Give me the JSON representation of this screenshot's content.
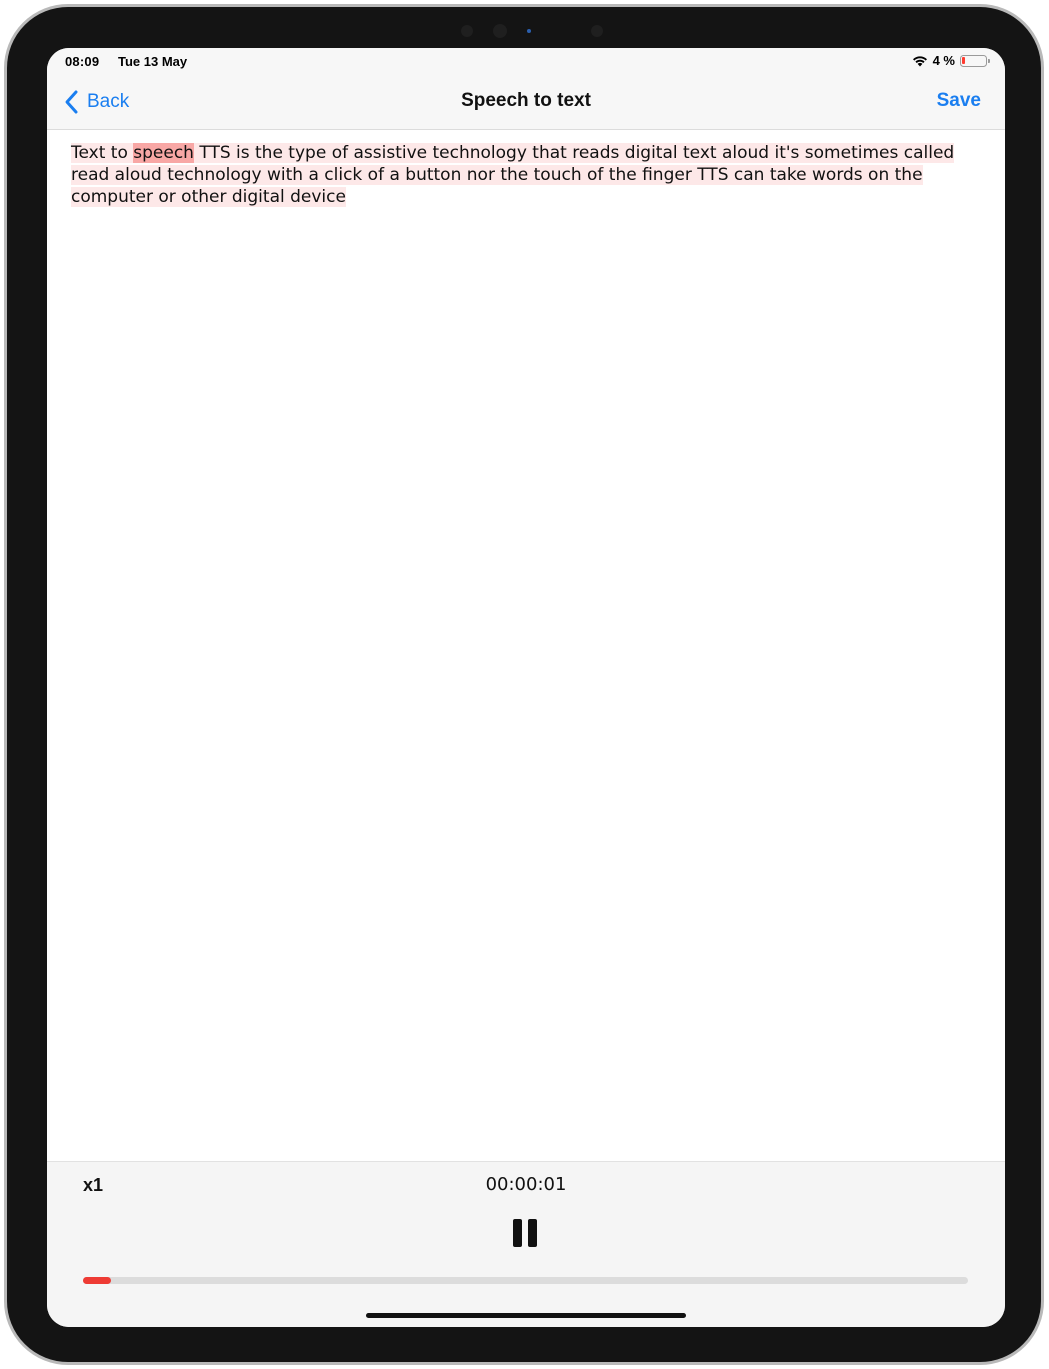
{
  "status_bar": {
    "time": "08:09",
    "date": "Tue 13 May",
    "battery_percent": "4 %",
    "battery_level": 0.04,
    "wifi_icon": "wifi-icon"
  },
  "nav": {
    "back_label": "Back",
    "title": "Speech to text",
    "save_label": "Save"
  },
  "content": {
    "before_highlight": "Text to ",
    "highlighted_word": "speech",
    "after_highlight": " TTS is the type of assistive technology that reads digital text aloud it's sometimes called read aloud technology with a click of a button nor the touch of the finger TTS can take words on the computer or other digital device"
  },
  "player": {
    "speed_label": "x1",
    "elapsed": "00:00:01",
    "pause_icon": "pause-icon",
    "progress": 0.03
  },
  "colors": {
    "accent": "#1a7ef0",
    "paragraph_highlight": "#fde8e8",
    "word_highlight": "#f8a7a5",
    "progress_fill": "#ee3b34"
  }
}
